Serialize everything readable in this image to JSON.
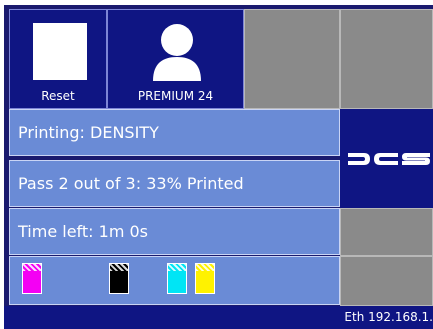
{
  "top_buttons": {
    "reset_label": "Reset",
    "user_label": "PREMIUM 24"
  },
  "status": {
    "printing": "Printing: DENSITY",
    "pass": "Pass 2 out of 3: 33% Printed",
    "time_left": "Time left: 1m 0s"
  },
  "ink_colors": {
    "magenta": "#f400f4",
    "black": "#000000",
    "cyan": "#00e5f5",
    "yellow": "#fff200"
  },
  "logo": {
    "name": "dcs-logo",
    "text": "DCS"
  },
  "footer": {
    "network": "Eth 192.168.1."
  },
  "theme": {
    "frame": "#1a1a6e",
    "tile": "#0f1583",
    "row": "#6a8bd6",
    "grey": "#8a8a8a"
  }
}
